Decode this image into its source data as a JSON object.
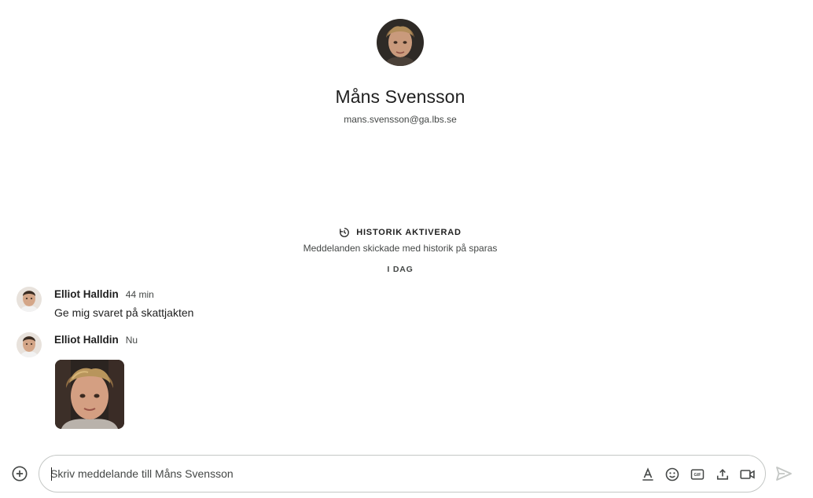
{
  "contact": {
    "name": "Måns Svensson",
    "email": "mans.svensson@ga.lbs.se",
    "avatar_icon": "person-photo-avatar"
  },
  "history": {
    "title": "HISTORIK AKTIVERAD",
    "subtitle": "Meddelanden skickade med historik på sparas",
    "icon": "history-icon"
  },
  "day_label": "I DAG",
  "messages": [
    {
      "sender": "Elliot Halldin",
      "time": "44 min",
      "text": "Ge mig svaret på skattjakten"
    },
    {
      "sender": "Elliot Halldin",
      "time": "Nu",
      "attachment": "image-photo"
    }
  ],
  "composer": {
    "placeholder": "Skriv meddelande till Måns Svensson",
    "value": "",
    "tools": [
      "format-text-icon",
      "emoji-icon",
      "gif-icon",
      "upload-icon",
      "video-meeting-icon"
    ],
    "gif_text": "GIF"
  },
  "colors": {
    "accent": "#0b57d0",
    "text": "#1f1f1f",
    "muted": "#444746",
    "border": "#c4c7c5",
    "icon": "#444746",
    "send_disabled": "#c4c7c5"
  }
}
